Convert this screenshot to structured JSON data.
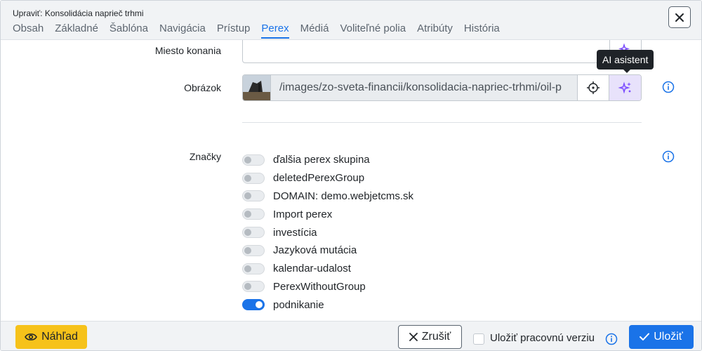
{
  "dialog": {
    "title": "Upraviť: Konsolidácia naprieč trhmi",
    "tabs": [
      {
        "label": "Obsah"
      },
      {
        "label": "Základné"
      },
      {
        "label": "Šablóna"
      },
      {
        "label": "Navigácia"
      },
      {
        "label": "Prístup"
      },
      {
        "label": "Perex",
        "active": true
      },
      {
        "label": "Médiá"
      },
      {
        "label": "Voliteľné polia"
      },
      {
        "label": "Atribúty"
      },
      {
        "label": "História"
      }
    ]
  },
  "form": {
    "location_label": "Miesto konania",
    "location_value": "",
    "image_label": "Obrázok",
    "image_path": "/images/zo-sveta-financii/konsolidacia-napriec-trhmi/oil-p",
    "tags_label": "Značky",
    "tags": [
      {
        "label": "ďalšia perex skupina",
        "checked": false
      },
      {
        "label": "deletedPerexGroup",
        "checked": false
      },
      {
        "label": "DOMAIN: demo.webjetcms.sk",
        "checked": false
      },
      {
        "label": "Import perex",
        "checked": false
      },
      {
        "label": "investícia",
        "checked": false
      },
      {
        "label": "Jazyková mutácia",
        "checked": false
      },
      {
        "label": "kalendar-udalost",
        "checked": false
      },
      {
        "label": "PerexWithoutGroup",
        "checked": false
      },
      {
        "label": "podnikanie",
        "checked": true
      }
    ]
  },
  "tooltip": {
    "text": "AI asistent"
  },
  "footer": {
    "preview_label": "Náhľad",
    "cancel_label": "Zrušiť",
    "save_draft_label": "Uložiť pracovnú verziu",
    "save_label": "Uložiť"
  },
  "colors": {
    "accent": "#1a73e8",
    "preview": "#f6c21a",
    "ai_button": "#e8e2fb"
  },
  "icons": [
    "close-icon",
    "crosshair-icon",
    "ai-sparkle-icon",
    "info-icon",
    "eye-icon",
    "x-icon",
    "check-icon"
  ]
}
